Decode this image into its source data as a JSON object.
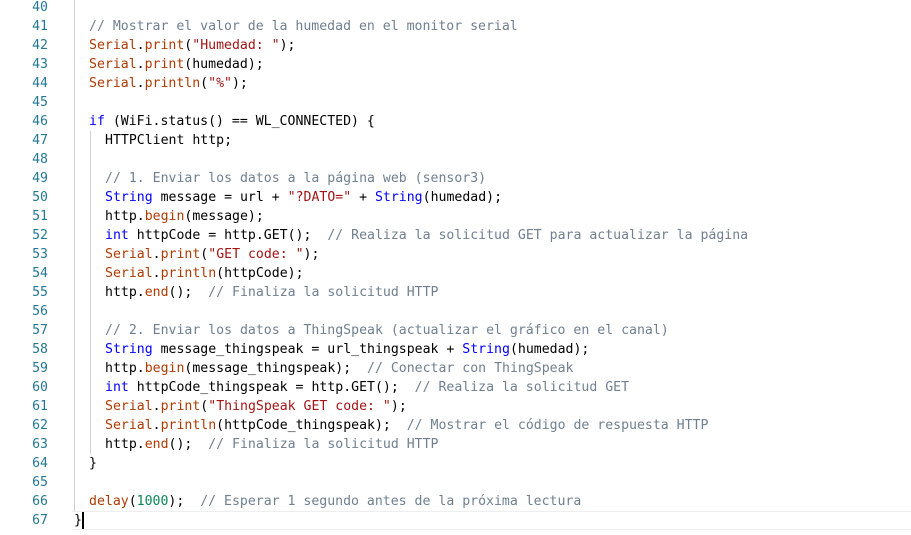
{
  "colors": {
    "line_number": "#237893",
    "comment": "#708090",
    "keyword": "#0000ff",
    "string": "#a31515",
    "function": "#af3a03",
    "number": "#098658",
    "text": "#000000"
  },
  "lines": [
    {
      "n": "40",
      "indent": 0,
      "tokens": []
    },
    {
      "n": "41",
      "indent": 0,
      "tokens": [
        [
          "c",
          "// Mostrar el valor de la humedad en el monitor serial"
        ]
      ]
    },
    {
      "n": "42",
      "indent": 0,
      "tokens": [
        [
          "f",
          "Serial"
        ],
        [
          "p",
          "."
        ],
        [
          "f",
          "print"
        ],
        [
          "p",
          "("
        ],
        [
          "s",
          "\"Humedad: \""
        ],
        [
          "p",
          ");"
        ]
      ]
    },
    {
      "n": "43",
      "indent": 0,
      "tokens": [
        [
          "f",
          "Serial"
        ],
        [
          "p",
          "."
        ],
        [
          "f",
          "print"
        ],
        [
          "p",
          "(humedad);"
        ]
      ]
    },
    {
      "n": "44",
      "indent": 0,
      "tokens": [
        [
          "f",
          "Serial"
        ],
        [
          "p",
          "."
        ],
        [
          "f",
          "println"
        ],
        [
          "p",
          "("
        ],
        [
          "s",
          "\"%\""
        ],
        [
          "p",
          ");"
        ]
      ]
    },
    {
      "n": "45",
      "indent": 0,
      "tokens": []
    },
    {
      "n": "46",
      "indent": 0,
      "tokens": [
        [
          "k",
          "if"
        ],
        [
          "p",
          " (WiFi.status() == WL_CONNECTED) {"
        ]
      ]
    },
    {
      "n": "47",
      "indent": 1,
      "tokens": [
        [
          "p",
          "HTTPClient http;"
        ]
      ]
    },
    {
      "n": "48",
      "indent": 1,
      "tokens": []
    },
    {
      "n": "49",
      "indent": 1,
      "tokens": [
        [
          "c",
          "// 1. Enviar los datos a la página web (sensor3)"
        ]
      ]
    },
    {
      "n": "50",
      "indent": 1,
      "tokens": [
        [
          "k",
          "String"
        ],
        [
          "p",
          " message = url + "
        ],
        [
          "s",
          "\"?DATO=\""
        ],
        [
          "p",
          " + "
        ],
        [
          "k",
          "String"
        ],
        [
          "p",
          "(humedad);"
        ]
      ]
    },
    {
      "n": "51",
      "indent": 1,
      "tokens": [
        [
          "p",
          "http."
        ],
        [
          "f",
          "begin"
        ],
        [
          "p",
          "(message);"
        ]
      ]
    },
    {
      "n": "52",
      "indent": 1,
      "tokens": [
        [
          "k",
          "int"
        ],
        [
          "p",
          " httpCode = http.GET();  "
        ],
        [
          "c",
          "// Realiza la solicitud GET para actualizar la página"
        ]
      ]
    },
    {
      "n": "53",
      "indent": 1,
      "tokens": [
        [
          "f",
          "Serial"
        ],
        [
          "p",
          "."
        ],
        [
          "f",
          "print"
        ],
        [
          "p",
          "("
        ],
        [
          "s",
          "\"GET code: \""
        ],
        [
          "p",
          ");"
        ]
      ]
    },
    {
      "n": "54",
      "indent": 1,
      "tokens": [
        [
          "f",
          "Serial"
        ],
        [
          "p",
          "."
        ],
        [
          "f",
          "println"
        ],
        [
          "p",
          "(httpCode);"
        ]
      ]
    },
    {
      "n": "55",
      "indent": 1,
      "tokens": [
        [
          "p",
          "http."
        ],
        [
          "f",
          "end"
        ],
        [
          "p",
          "();  "
        ],
        [
          "c",
          "// Finaliza la solicitud HTTP"
        ]
      ]
    },
    {
      "n": "56",
      "indent": 1,
      "tokens": []
    },
    {
      "n": "57",
      "indent": 1,
      "tokens": [
        [
          "c",
          "// 2. Enviar los datos a ThingSpeak (actualizar el gráfico en el canal)"
        ]
      ]
    },
    {
      "n": "58",
      "indent": 1,
      "tokens": [
        [
          "k",
          "String"
        ],
        [
          "p",
          " message_thingspeak = url_thingspeak + "
        ],
        [
          "k",
          "String"
        ],
        [
          "p",
          "(humedad);"
        ]
      ]
    },
    {
      "n": "59",
      "indent": 1,
      "tokens": [
        [
          "p",
          "http."
        ],
        [
          "f",
          "begin"
        ],
        [
          "p",
          "(message_thingspeak);  "
        ],
        [
          "c",
          "// Conectar con ThingSpeak"
        ]
      ]
    },
    {
      "n": "60",
      "indent": 1,
      "tokens": [
        [
          "k",
          "int"
        ],
        [
          "p",
          " httpCode_thingspeak = http.GET();  "
        ],
        [
          "c",
          "// Realiza la solicitud GET"
        ]
      ]
    },
    {
      "n": "61",
      "indent": 1,
      "tokens": [
        [
          "f",
          "Serial"
        ],
        [
          "p",
          "."
        ],
        [
          "f",
          "print"
        ],
        [
          "p",
          "("
        ],
        [
          "s",
          "\"ThingSpeak GET code: \""
        ],
        [
          "p",
          ");"
        ]
      ]
    },
    {
      "n": "62",
      "indent": 1,
      "tokens": [
        [
          "f",
          "Serial"
        ],
        [
          "p",
          "."
        ],
        [
          "f",
          "println"
        ],
        [
          "p",
          "(httpCode_thingspeak);  "
        ],
        [
          "c",
          "// Mostrar el código de respuesta HTTP"
        ]
      ]
    },
    {
      "n": "63",
      "indent": 1,
      "tokens": [
        [
          "p",
          "http."
        ],
        [
          "f",
          "end"
        ],
        [
          "p",
          "();  "
        ],
        [
          "c",
          "// Finaliza la solicitud HTTP"
        ]
      ]
    },
    {
      "n": "64",
      "indent": 0,
      "tokens": [
        [
          "p",
          "}"
        ]
      ]
    },
    {
      "n": "65",
      "indent": 0,
      "tokens": []
    },
    {
      "n": "66",
      "indent": 0,
      "tokens": [
        [
          "f",
          "delay"
        ],
        [
          "p",
          "("
        ],
        [
          "n",
          "1000"
        ],
        [
          "p",
          ");  "
        ],
        [
          "c",
          "// Esperar 1 segundo antes de la próxima lectura"
        ]
      ]
    },
    {
      "n": "67",
      "indent": -1,
      "tokens": [
        [
          "p",
          "}"
        ]
      ]
    }
  ]
}
